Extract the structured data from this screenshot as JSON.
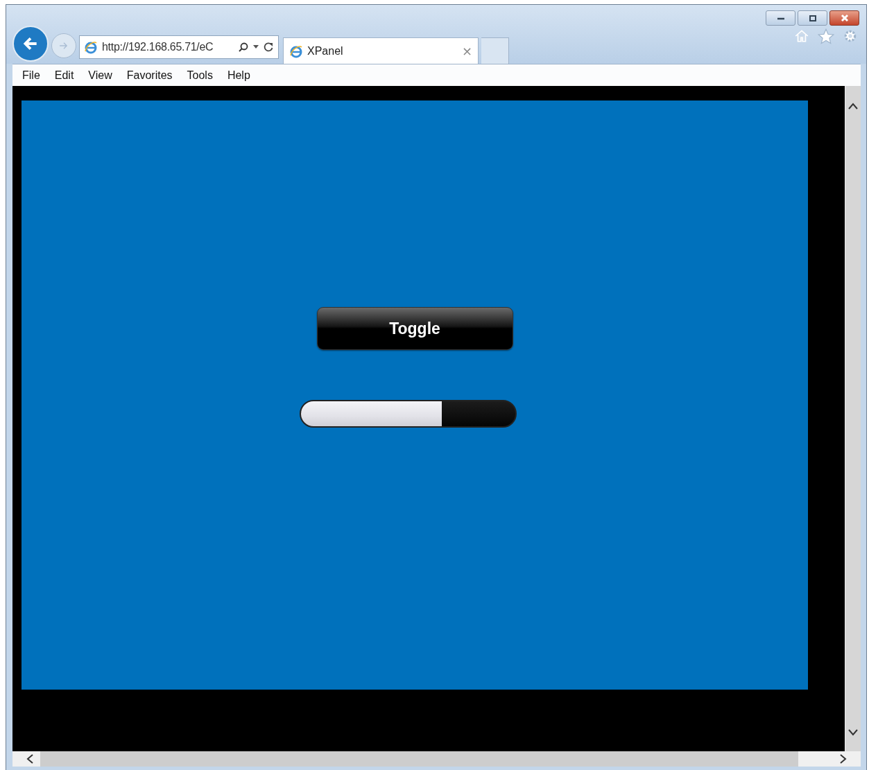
{
  "window": {
    "title_buttons": [
      {
        "kind": "minimize"
      },
      {
        "kind": "maximize"
      },
      {
        "kind": "close"
      }
    ]
  },
  "address_bar": {
    "value": "http://192.168.65.71/eC"
  },
  "tabs": [
    {
      "label": "XPanel",
      "selected": true,
      "close": "×"
    }
  ],
  "menu": [
    "File",
    "Edit",
    "View",
    "Favorites",
    "Tools",
    "Help"
  ],
  "panel": {
    "button": "Toggle",
    "progress": {
      "level": 0.66
    }
  }
}
